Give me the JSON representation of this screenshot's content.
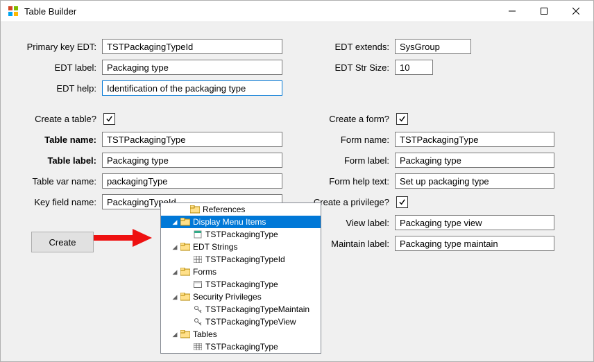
{
  "window": {
    "title": "Table Builder"
  },
  "left": {
    "primary_key_edt": {
      "label": "Primary key EDT:",
      "value": "TSTPackagingTypeId"
    },
    "edt_label": {
      "label": "EDT label:",
      "value": "Packaging type"
    },
    "edt_help": {
      "label": "EDT help:",
      "value": "Identification of the packaging type"
    },
    "create_table": {
      "label": "Create a table?"
    },
    "table_name": {
      "label": "Table name:",
      "value": "TSTPackagingType"
    },
    "table_label": {
      "label": "Table label:",
      "value": "Packaging type"
    },
    "table_var": {
      "label": "Table var name:",
      "value": "packagingType"
    },
    "key_field": {
      "label": "Key field name:",
      "value": "PackagingTypeId"
    },
    "create_btn": "Create"
  },
  "right": {
    "edt_extends": {
      "label": "EDT extends:",
      "value": "SysGroup"
    },
    "edt_str_size": {
      "label": "EDT Str Size:",
      "value": "10"
    },
    "create_form": {
      "label": "Create a form?"
    },
    "form_name": {
      "label": "Form name:",
      "value": "TSTPackagingType"
    },
    "form_label": {
      "label": "Form label:",
      "value": "Packaging type"
    },
    "form_help": {
      "label": "Form help text:",
      "value": "Set up packaging type"
    },
    "create_priv": {
      "label": "Create a privilege?"
    },
    "view_label": {
      "label": "View label:",
      "value": "Packaging type view"
    },
    "maintain_label": {
      "label": "Maintain label:",
      "value": "Packaging type maintain"
    }
  },
  "tree": {
    "n0": "References",
    "n1": "Display Menu Items",
    "n1a": "TSTPackagingType",
    "n2": "EDT Strings",
    "n2a": "TSTPackagingTypeId",
    "n3": "Forms",
    "n3a": "TSTPackagingType",
    "n4": "Security Privileges",
    "n4a": "TSTPackagingTypeMaintain",
    "n4b": "TSTPackagingTypeView",
    "n5": "Tables",
    "n5a": "TSTPackagingType"
  }
}
